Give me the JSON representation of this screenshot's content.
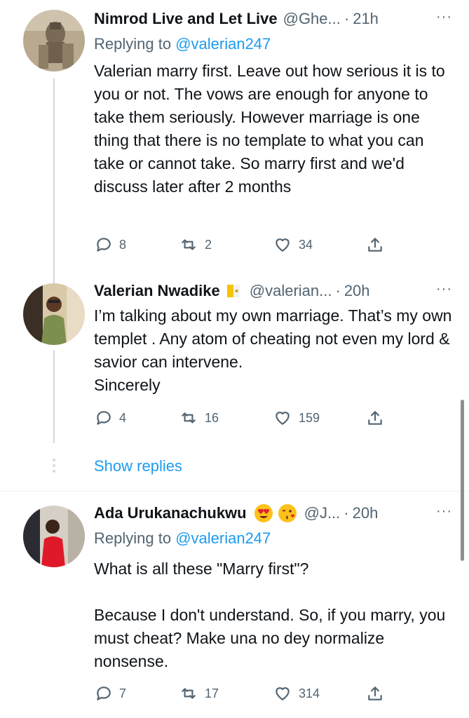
{
  "tweets": [
    {
      "name": "Nimrod Live and Let Live",
      "handle": "@Ghe...",
      "dot": "·",
      "time": "21h",
      "more": "···",
      "replying_prefix": "Replying to ",
      "replying_to": "@valerian247",
      "body": "Valerian marry first. Leave out how serious it is to you or not. The vows are enough for anyone to take them seriously. However marriage is one thing that there is no template to what you can take or cannot take. So marry first and we'd discuss later after 2 months",
      "replies": "8",
      "retweets": "2",
      "likes": "34",
      "avatar_icon": "statue-avatar"
    },
    {
      "name": "Valerian Nwadike",
      "handle": "@valerian...",
      "dot": "·",
      "time": "20h",
      "more": "···",
      "badge_icon": "vatican-flag-icon",
      "body": "I’m talking about my own marriage. That’s my own templet . Any atom of cheating not even my lord & savior can intervene.\nSincerely",
      "replies": "4",
      "retweets": "16",
      "likes": "159",
      "avatar_icon": "man-selfie-avatar"
    },
    {
      "name": "Ada Urukanachukwu",
      "handle": "@J...",
      "dot": "·",
      "time": "20h",
      "more": "···",
      "name_emojis": [
        "heart-eyes-emoji",
        "kissing-face-emoji"
      ],
      "replying_prefix": "Replying to ",
      "replying_to": "@valerian247",
      "body": "What is all these \"Marry first\"?\n\nBecause I don't understand. So, if you marry, you must cheat? Make una no dey normalize nonsense.",
      "replies": "7",
      "retweets": "17",
      "likes": "314",
      "avatar_icon": "woman-red-dress-avatar"
    }
  ],
  "show_replies": "Show replies",
  "colors": {
    "link": "#1d9bf0",
    "muted": "#536471",
    "text": "#0f1419",
    "thread": "#cfd9de"
  }
}
